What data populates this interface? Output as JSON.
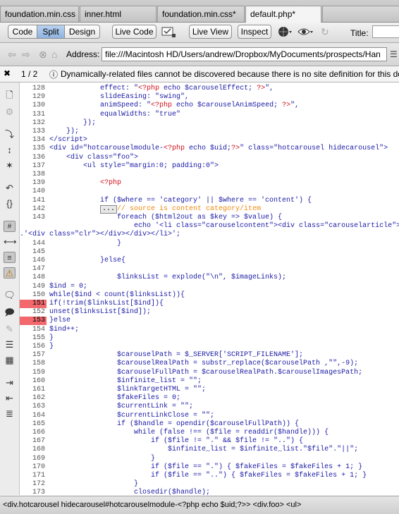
{
  "tabs": [
    {
      "label": "foundation.min.css",
      "active": false
    },
    {
      "label": "inner.html",
      "active": false
    },
    {
      "label": "foundation.min.css*",
      "active": false
    },
    {
      "label": "default.php*",
      "active": true
    }
  ],
  "toolbar": {
    "views": [
      "Code",
      "Split",
      "Design"
    ],
    "selected_view": "Split",
    "live_code": "Live Code",
    "live_view": "Live View",
    "inspect": "Inspect",
    "title_label": "Title:"
  },
  "address": {
    "label": "Address:",
    "value": "file:///Macintosh HD/Users/andrew/Dropbox/MyDocuments/prospects/Han"
  },
  "infobar": {
    "page": "1 / 2",
    "message": "Dynamically-related files cannot be discovered because there is no site definition for this docu"
  },
  "code_lines": [
    {
      "n": "128",
      "err": false,
      "html": "            effect: \"<span class='php'>&lt;?php</span> echo $carouselEffect; <span class='php'>?&gt;</span>\","
    },
    {
      "n": "129",
      "err": false,
      "html": "            slideEasing: \"swing\","
    },
    {
      "n": "130",
      "err": false,
      "html": "            animSpeed: \"<span class='php'>&lt;?php</span> echo $carouselAnimSpeed; <span class='php'>?&gt;</span>\","
    },
    {
      "n": "131",
      "err": false,
      "html": "            equalWidths: \"true\""
    },
    {
      "n": "132",
      "err": false,
      "html": "        });"
    },
    {
      "n": "133",
      "err": false,
      "html": "    });"
    },
    {
      "n": "134",
      "err": false,
      "html": "&lt;/script&gt;"
    },
    {
      "n": "135",
      "err": false,
      "html": "&lt;div id=\"hotcarouselmodule-<span class='php'>&lt;?php</span> echo $uid;<span class='php'>?&gt;</span>\" class=\"hotcarousel hidecarousel\"&gt;"
    },
    {
      "n": "136",
      "err": false,
      "html": "    &lt;div class=\"foo\"&gt;"
    },
    {
      "n": "137",
      "err": false,
      "html": "        &lt;ul style=\"margin:0; padding:0\"&gt;"
    },
    {
      "n": "138",
      "err": false,
      "html": ""
    },
    {
      "n": "139",
      "err": false,
      "html": "            <span class='php'>&lt;?php</span>"
    },
    {
      "n": "140",
      "err": false,
      "html": ""
    },
    {
      "n": "141",
      "err": false,
      "html": "            if ($where == 'category' || $where == 'content') {"
    },
    {
      "n": "142",
      "err": false,
      "html": "            <span class='fold'>...</span><span class='cm'>// source is content category/item</span>"
    },
    {
      "n": "143",
      "err": false,
      "html": "                foreach ($html2out as $key =&gt; $value) {"
    },
    {
      "n": "",
      "err": false,
      "html": "                    echo '&lt;li class=\"carouselcontent\"&gt;&lt;div class=\"carouselarticle\"&gt;"
    },
    {
      "n": "",
      "err": false,
      "html": "<span style='position:absolute;left:-42px'>.'&lt;div class=\"clr\"&gt;&lt;/div&gt;&lt;/div&gt;&lt;/li&gt;';</span>"
    },
    {
      "n": "144",
      "err": false,
      "html": "                }"
    },
    {
      "n": "145",
      "err": false,
      "html": ""
    },
    {
      "n": "146",
      "err": false,
      "html": "            }else{"
    },
    {
      "n": "147",
      "err": false,
      "html": ""
    },
    {
      "n": "148",
      "err": false,
      "html": "                $linksList = explode(\"\\n\", $imageLinks);"
    },
    {
      "n": "149",
      "err": false,
      "html": "$ind = 0;"
    },
    {
      "n": "150",
      "err": false,
      "html": "while($ind &lt; count($linksList)){"
    },
    {
      "n": "151",
      "err": true,
      "html": "if(!trim($linksList[$ind]){"
    },
    {
      "n": "152",
      "err": false,
      "html": "unset($linksList[$ind]);"
    },
    {
      "n": "153",
      "err": true,
      "html": "}else"
    },
    {
      "n": "154",
      "err": false,
      "html": "$ind++;"
    },
    {
      "n": "155",
      "err": false,
      "html": "}"
    },
    {
      "n": "156",
      "err": false,
      "html": "}"
    },
    {
      "n": "157",
      "err": false,
      "html": "                $carouselPath = $_SERVER['SCRIPT_FILENAME'];"
    },
    {
      "n": "158",
      "err": false,
      "html": "                $carouselRealPath = substr_replace($carouselPath ,\"\",-9);"
    },
    {
      "n": "159",
      "err": false,
      "html": "                $carouselFullPath = $carouselRealPath.$carouselImagesPath;"
    },
    {
      "n": "160",
      "err": false,
      "html": "                $infinite_list = \"\";"
    },
    {
      "n": "161",
      "err": false,
      "html": "                $linkTargetHTML = \"\";"
    },
    {
      "n": "162",
      "err": false,
      "html": "                $fakeFiles = 0;"
    },
    {
      "n": "163",
      "err": false,
      "html": "                $currentLink = \"\";"
    },
    {
      "n": "164",
      "err": false,
      "html": "                $currentLinkClose = \"\";"
    },
    {
      "n": "165",
      "err": false,
      "html": "                if ($handle = opendir($carouselFullPath)) {"
    },
    {
      "n": "166",
      "err": false,
      "html": "                    while (false !== ($file = readdir($handle))) {"
    },
    {
      "n": "167",
      "err": false,
      "html": "                        if ($file != \".\" &amp;&amp; $file != \"..\") {"
    },
    {
      "n": "168",
      "err": false,
      "html": "                            $infinite_list = $infinite_list.\"$file\".\"||\";"
    },
    {
      "n": "169",
      "err": false,
      "html": "                        }"
    },
    {
      "n": "170",
      "err": false,
      "html": "                        if ($file == \".\") { $fakeFiles = $fakeFiles + 1; }"
    },
    {
      "n": "171",
      "err": false,
      "html": "                        if ($file == \"..\") { $fakeFiles = $fakeFiles + 1; }"
    },
    {
      "n": "172",
      "err": false,
      "html": "                    }"
    },
    {
      "n": "173",
      "err": false,
      "html": "                    closedir($handle);"
    }
  ],
  "statusbar": {
    "path": "<div.hotcarousel hidecarousel#hotcarouselmodule-<?php echo $uid;?>> <div.foo> <ul>"
  }
}
